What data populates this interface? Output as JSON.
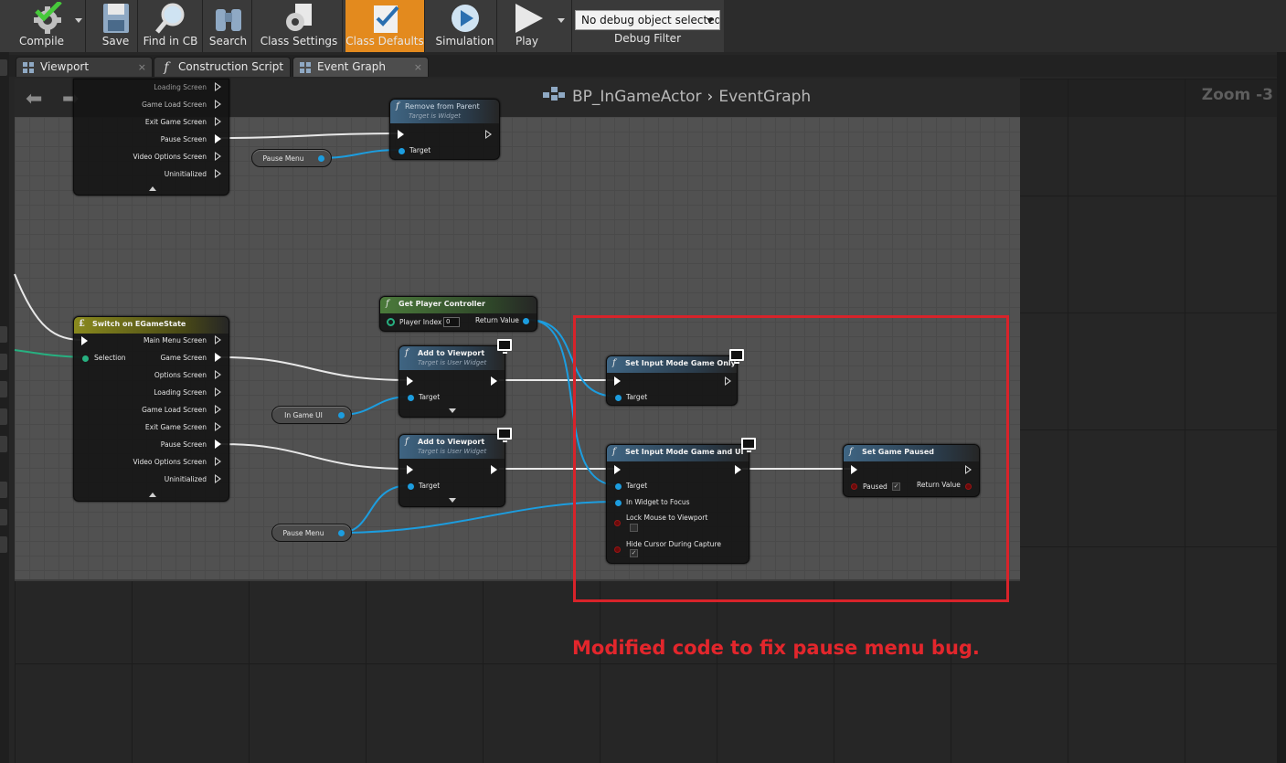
{
  "toolbar": {
    "buttons": [
      {
        "label": "Compile",
        "icon": "compile-gear-check-icon"
      },
      {
        "label": "Save",
        "icon": "floppy-disk-icon"
      },
      {
        "label": "Find in CB",
        "icon": "magnifier-icon"
      },
      {
        "label": "Search",
        "icon": "binoculars-icon"
      },
      {
        "label": "Class Settings",
        "icon": "gear-document-icon"
      },
      {
        "label": "Class Defaults",
        "icon": "checklist-icon",
        "active": true
      },
      {
        "label": "Simulation",
        "icon": "simulate-play-icon"
      },
      {
        "label": "Play",
        "icon": "play-triangle-icon"
      }
    ],
    "debug_filter": {
      "selected": "No debug object selected",
      "label": "Debug Filter"
    },
    "active_color": "#e38a1e"
  },
  "tabs": [
    {
      "label": "Viewport",
      "icon": "grid-icon",
      "close": "×"
    },
    {
      "label": "Construction Script",
      "icon": "function-icon",
      "icon_glyph": "f"
    },
    {
      "label": "Event Graph",
      "icon": "grid-icon",
      "close": "×",
      "active": true
    }
  ],
  "graph": {
    "breadcrumb": {
      "blueprint": "BP_InGameActor",
      "separator": "›",
      "graph": "EventGraph"
    },
    "zoom": "Zoom -3",
    "nav_back": "⬅",
    "nav_forward": "➡"
  },
  "nodes": {
    "switch_top_partial": {
      "outputs": [
        "Loading Screen",
        "Game Load Screen",
        "Exit Game Screen",
        "Pause Screen",
        "Video Options Screen",
        "Uninitialized"
      ]
    },
    "remove_from_parent": {
      "title": "Remove from Parent",
      "subtitle": "Target is Widget",
      "pin_target": "Target"
    },
    "pause_menu_var_top": {
      "label": "Pause Menu"
    },
    "get_player_controller": {
      "title": "Get Player Controller",
      "pin_player_index": "Player Index",
      "player_index_value": "0",
      "pin_return": "Return Value"
    },
    "switch_egamestate": {
      "title": "Switch on EGameState",
      "pin_selection": "Selection",
      "outputs": [
        "Main Menu Screen",
        "Game Screen",
        "Options Screen",
        "Loading Screen",
        "Game Load Screen",
        "Exit Game Screen",
        "Pause Screen",
        "Video Options Screen",
        "Uninitialized"
      ]
    },
    "add_to_viewport_1": {
      "title": "Add to Viewport",
      "subtitle": "Target is User Widget",
      "pin_target": "Target"
    },
    "add_to_viewport_2": {
      "title": "Add to Viewport",
      "subtitle": "Target is User Widget",
      "pin_target": "Target"
    },
    "in_game_ui_var": {
      "label": "In Game UI"
    },
    "pause_menu_var_bottom": {
      "label": "Pause Menu"
    },
    "set_input_mode_game_only": {
      "title": "Set Input Mode Game Only",
      "pin_target": "Target"
    },
    "set_input_mode_game_and_ui": {
      "title": "Set Input Mode Game and UI",
      "pin_target": "Target",
      "pin_widget": "In Widget to Focus",
      "pin_lock": "Lock Mouse to Viewport",
      "pin_hide": "Hide Cursor During Capture",
      "lock_checked": false,
      "hide_checked": true
    },
    "set_game_paused": {
      "title": "Set Game Paused",
      "pin_paused": "Paused",
      "paused_checked": true,
      "pin_return": "Return Value"
    }
  },
  "annotation": {
    "text": "Modified code to fix pause menu bug.",
    "color": "#e3262c"
  }
}
